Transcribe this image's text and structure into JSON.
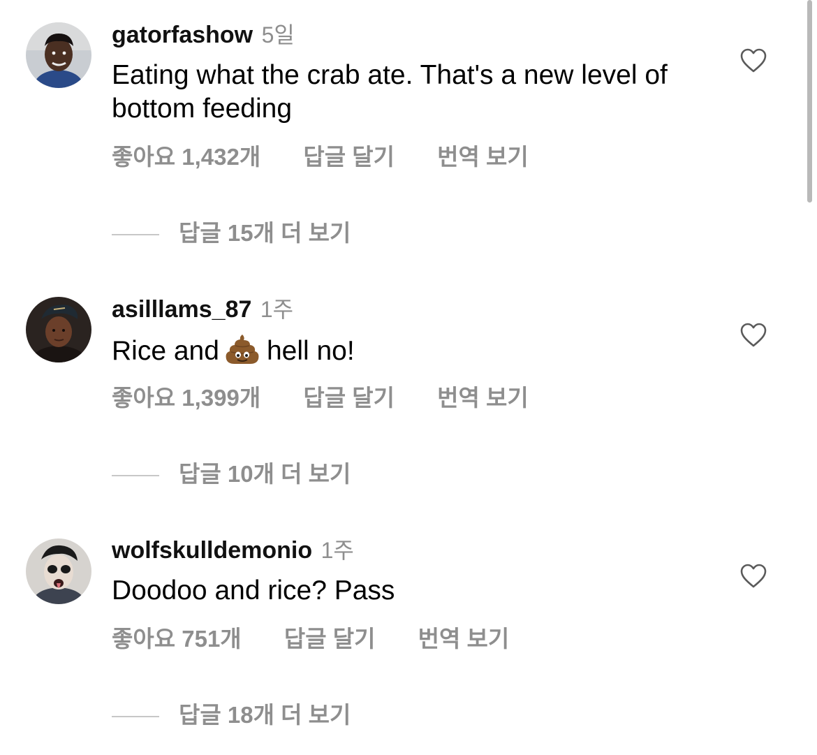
{
  "comments": [
    {
      "username": "gatorfashow",
      "time": "5일",
      "text": "Eating what the crab ate. That's a new level of bottom feeding",
      "likes": "좋아요 1,432개",
      "reply": "답글 달기",
      "translate": "번역 보기",
      "more_replies": "답글 15개 더 보기"
    },
    {
      "username": "asilllams_87",
      "time": "1주",
      "text_before": "Rice and",
      "emoji": "pile-of-poo",
      "text_after": "hell no!",
      "likes": "좋아요 1,399개",
      "reply": "답글 달기",
      "translate": "번역 보기",
      "more_replies": "답글 10개 더 보기"
    },
    {
      "username": "wolfskulldemonio",
      "time": "1주",
      "text": "Doodoo and rice? Pass",
      "likes": "좋아요 751개",
      "reply": "답글 달기",
      "translate": "번역 보기",
      "more_replies": "답글 18개 더 보기"
    }
  ],
  "colors": {
    "secondary_text": "#8e8e8e",
    "divider": "#c7c7c7",
    "scrollbar": "#b9b9b9"
  }
}
